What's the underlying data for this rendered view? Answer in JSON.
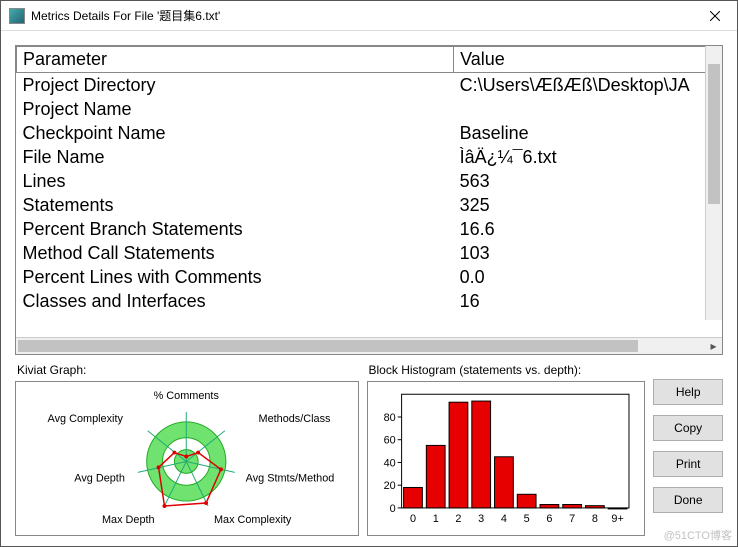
{
  "window": {
    "title": "Metrics Details For File '题目集6.txt'"
  },
  "table": {
    "headers": {
      "param": "Parameter",
      "value": "Value"
    },
    "rows": [
      {
        "param": "Project Directory",
        "value": "C:\\Users\\ÆßÆß\\Desktop\\JA"
      },
      {
        "param": "Project Name",
        "value": ""
      },
      {
        "param": "Checkpoint Name",
        "value": "Baseline"
      },
      {
        "param": "File Name",
        "value": "ÌâÄ¿¼¯6.txt"
      },
      {
        "param": "Lines",
        "value": "563"
      },
      {
        "param": "Statements",
        "value": "325"
      },
      {
        "param": "Percent Branch Statements",
        "value": "16.6"
      },
      {
        "param": "Method Call Statements",
        "value": "103"
      },
      {
        "param": "Percent Lines with Comments",
        "value": "0.0"
      },
      {
        "param": "Classes and Interfaces",
        "value": "16"
      }
    ]
  },
  "kiviat": {
    "title": "Kiviat Graph:",
    "labels": {
      "pct_comments": "% Comments",
      "methods_class": "Methods/Class",
      "avg_stmts_method": "Avg Stmts/Method",
      "max_complexity": "Max Complexity",
      "max_depth": "Max Depth",
      "avg_depth": "Avg Depth",
      "avg_complexity": "Avg Complexity"
    }
  },
  "histogram": {
    "title": "Block Histogram (statements vs. depth):"
  },
  "buttons": {
    "help": "Help",
    "copy": "Copy",
    "print": "Print",
    "done": "Done"
  },
  "chart_data": {
    "type": "bar",
    "categories": [
      "0",
      "1",
      "2",
      "3",
      "4",
      "5",
      "6",
      "7",
      "8",
      "9+"
    ],
    "values": [
      18,
      55,
      93,
      94,
      45,
      12,
      3,
      3,
      2,
      0
    ],
    "xlabel": "",
    "ylabel": "",
    "ylim": [
      0,
      100
    ],
    "yticks": [
      0,
      20,
      40,
      60,
      80
    ]
  },
  "watermark": "@51CTO博客"
}
